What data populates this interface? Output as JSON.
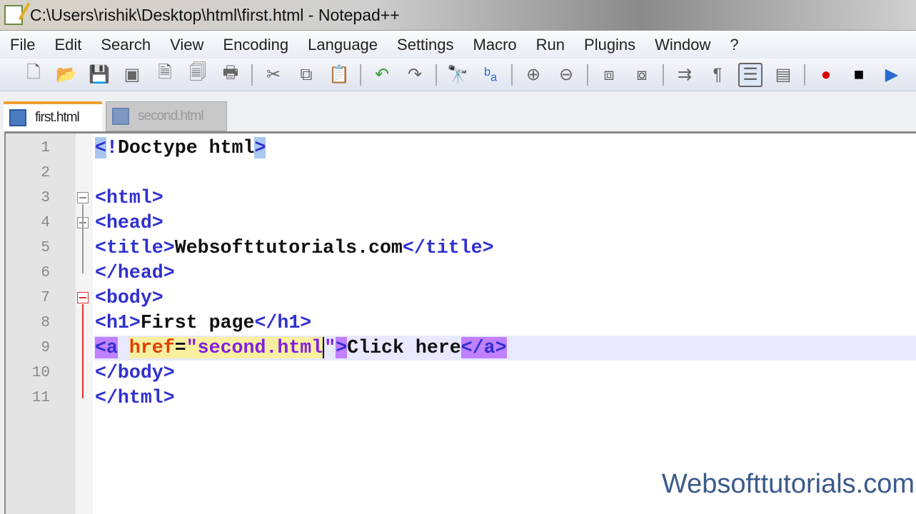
{
  "window": {
    "title": "C:\\Users\\rishik\\Desktop\\html\\first.html - Notepad++"
  },
  "menu": [
    "File",
    "Edit",
    "Search",
    "View",
    "Encoding",
    "Language",
    "Settings",
    "Macro",
    "Run",
    "Plugins",
    "Window",
    "?"
  ],
  "toolbar": [
    {
      "icon": "new-file-icon",
      "glyph": "🗋"
    },
    {
      "icon": "open-file-icon",
      "glyph": "📂"
    },
    {
      "icon": "save-icon",
      "glyph": "💾"
    },
    {
      "icon": "save-all-icon",
      "glyph": "▣"
    },
    {
      "icon": "close-icon",
      "glyph": "🗎"
    },
    {
      "icon": "close-all-icon",
      "glyph": "🗐"
    },
    {
      "icon": "print-icon",
      "glyph": "🖶"
    },
    {
      "sep": true
    },
    {
      "icon": "cut-icon",
      "glyph": "✂"
    },
    {
      "icon": "copy-icon",
      "glyph": "⧉"
    },
    {
      "icon": "paste-icon",
      "glyph": "📋"
    },
    {
      "sep": true
    },
    {
      "icon": "undo-icon",
      "glyph": "↶"
    },
    {
      "icon": "redo-icon",
      "glyph": "↷"
    },
    {
      "sep": true
    },
    {
      "icon": "find-icon",
      "glyph": "🔭"
    },
    {
      "icon": "replace-icon",
      "glyph": "ᵇₐ"
    },
    {
      "sep": true
    },
    {
      "icon": "zoom-in-icon",
      "glyph": "⊕"
    },
    {
      "icon": "zoom-out-icon",
      "glyph": "⊖"
    },
    {
      "sep": true
    },
    {
      "icon": "sync-vertical-icon",
      "glyph": "⧈"
    },
    {
      "icon": "sync-horizontal-icon",
      "glyph": "⧇"
    },
    {
      "sep": true
    },
    {
      "icon": "word-wrap-icon",
      "glyph": "⇉"
    },
    {
      "icon": "show-all-chars-icon",
      "glyph": "¶"
    },
    {
      "icon": "indent-guide-icon",
      "glyph": "☰",
      "active": true
    },
    {
      "icon": "user-lang-icon",
      "glyph": "▤"
    },
    {
      "sep": true
    },
    {
      "icon": "record-macro-icon",
      "glyph": "●"
    },
    {
      "icon": "stop-macro-icon",
      "glyph": "■"
    },
    {
      "icon": "play-macro-icon",
      "glyph": "▶"
    }
  ],
  "tabs": [
    {
      "label": "first.html",
      "active": true
    },
    {
      "label": "second.html",
      "active": false
    }
  ],
  "editor": {
    "current_line": 9,
    "lines": [
      {
        "n": "1",
        "tokens": [
          [
            "t hb",
            "<"
          ],
          [
            "t",
            "!"
          ],
          [
            "x",
            "Doctype html"
          ],
          [
            "t hb",
            ">"
          ]
        ]
      },
      {
        "n": "2",
        "tokens": []
      },
      {
        "n": "3",
        "tokens": [
          [
            "t",
            "<html>"
          ]
        ]
      },
      {
        "n": "4",
        "tokens": [
          [
            "t",
            "<head>"
          ]
        ]
      },
      {
        "n": "5",
        "tokens": [
          [
            "t",
            "<title>"
          ],
          [
            "x",
            "Websofttutorials.com"
          ],
          [
            "t",
            "</title>"
          ]
        ]
      },
      {
        "n": "6",
        "tokens": [
          [
            "t",
            "</head>"
          ]
        ]
      },
      {
        "n": "7",
        "tokens": [
          [
            "t",
            "<body>"
          ]
        ]
      },
      {
        "n": "8",
        "tokens": [
          [
            "t",
            "<h1>"
          ],
          [
            "x",
            "First page"
          ],
          [
            "t",
            "</h1>"
          ]
        ]
      },
      {
        "n": "9",
        "tokens": [
          [
            "t hp",
            "<a"
          ],
          [
            "o",
            " "
          ],
          [
            "a hy",
            "href"
          ],
          [
            "o hy",
            "="
          ],
          [
            "v hy",
            "\"second.html"
          ],
          [
            "v",
            "\""
          ],
          [
            "t hp",
            ">"
          ],
          [
            "x",
            "Click here"
          ],
          [
            "t hp",
            "</a>"
          ]
        ]
      },
      {
        "n": "10",
        "tokens": [
          [
            "t",
            "</body>"
          ]
        ]
      },
      {
        "n": "11",
        "tokens": [
          [
            "t",
            "</html>"
          ]
        ]
      }
    ]
  },
  "watermark": "Websofttutorials.com",
  "colors": {
    "tag": "#3030d0",
    "attribute": "#e04000",
    "value": "#8020e0",
    "current_line": "#e8e8ff",
    "brace_match": "#c080ff"
  }
}
